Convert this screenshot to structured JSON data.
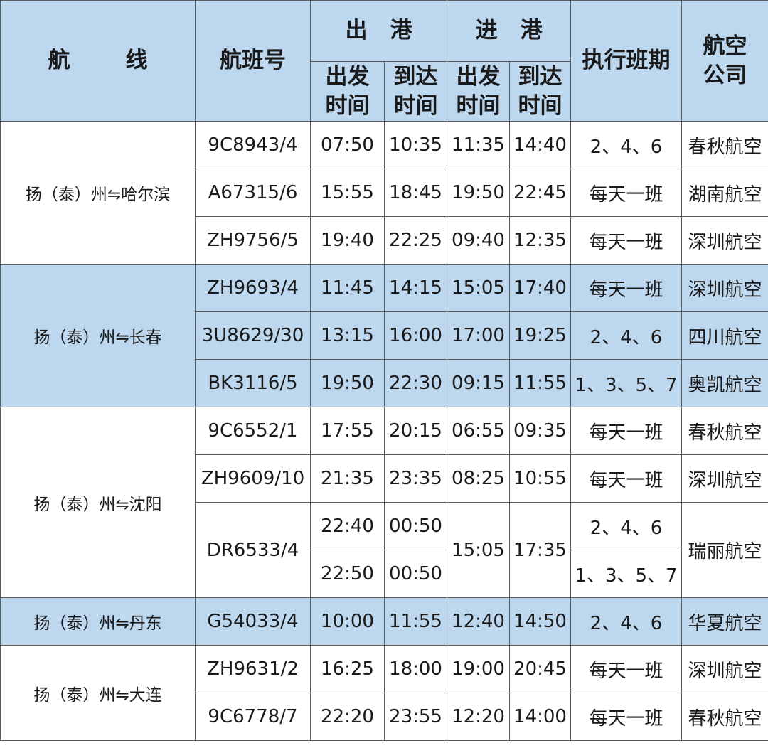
{
  "header": {
    "route": [
      "航",
      "线"
    ],
    "flight_no": "航班号",
    "outbound": [
      "出",
      "港"
    ],
    "inbound": [
      "进",
      "港"
    ],
    "depart": [
      "出发",
      "时间"
    ],
    "arrive": [
      "到达",
      "时间"
    ],
    "schedule": "执行班期",
    "airline": [
      "航空",
      "公司"
    ]
  },
  "routes": [
    {
      "name": "扬（泰）州⇋哈尔滨",
      "flights": [
        {
          "no": "9C8943/4",
          "out_dep": "07:50",
          "out_arr": "10:35",
          "in_dep": "11:35",
          "in_arr": "14:40",
          "schedule": "2、4、6",
          "airline": "春秋航空"
        },
        {
          "no": "A67315/6",
          "out_dep": "15:55",
          "out_arr": "18:45",
          "in_dep": "19:50",
          "in_arr": "22:45",
          "schedule": "每天一班",
          "airline": "湖南航空"
        },
        {
          "no": "ZH9756/5",
          "out_dep": "19:40",
          "out_arr": "22:25",
          "in_dep": "09:40",
          "in_arr": "12:35",
          "schedule": "每天一班",
          "airline": "深圳航空"
        }
      ]
    },
    {
      "name": "扬（泰）州⇋长春",
      "flights": [
        {
          "no": "ZH9693/4",
          "out_dep": "11:45",
          "out_arr": "14:15",
          "in_dep": "15:05",
          "in_arr": "17:40",
          "schedule": "每天一班",
          "airline": "深圳航空"
        },
        {
          "no": "3U8629/30",
          "out_dep": "13:15",
          "out_arr": "16:00",
          "in_dep": "17:00",
          "in_arr": "19:25",
          "schedule": "2、4、6",
          "airline": "四川航空"
        },
        {
          "no": "BK3116/5",
          "out_dep": "19:50",
          "out_arr": "22:30",
          "in_dep": "09:15",
          "in_arr": "11:55",
          "schedule": "1、3、5、7",
          "airline": "奥凯航空"
        }
      ]
    },
    {
      "name": "扬（泰）州⇋沈阳",
      "flights": [
        {
          "no": "9C6552/1",
          "out_dep": "17:55",
          "out_arr": "20:15",
          "in_dep": "06:55",
          "in_arr": "09:35",
          "schedule": "每天一班",
          "airline": "春秋航空"
        },
        {
          "no": "ZH9609/10",
          "out_dep": "21:35",
          "out_arr": "23:35",
          "in_dep": "08:25",
          "in_arr": "10:55",
          "schedule": "每天一班",
          "airline": "深圳航空"
        },
        {
          "no": "DR6533/4",
          "in_dep": "15:05",
          "in_arr": "17:35",
          "airline": "瑞丽航空",
          "variants": [
            {
              "out_dep": "22:40",
              "out_arr": "00:50",
              "schedule": "2、4、6"
            },
            {
              "out_dep": "22:50",
              "out_arr": "00:50",
              "schedule": "1、3、5、7"
            }
          ]
        }
      ]
    },
    {
      "name": "扬（泰）州⇋丹东",
      "flights": [
        {
          "no": "G54033/4",
          "out_dep": "10:00",
          "out_arr": "11:55",
          "in_dep": "12:40",
          "in_arr": "14:50",
          "schedule": "2、4、6",
          "airline": "华夏航空"
        }
      ]
    },
    {
      "name": "扬（泰）州⇋大连",
      "flights": [
        {
          "no": "ZH9631/2",
          "out_dep": "16:25",
          "out_arr": "18:00",
          "in_dep": "19:00",
          "in_arr": "20:45",
          "schedule": "每天一班",
          "airline": "深圳航空"
        },
        {
          "no": "9C6778/7",
          "out_dep": "22:20",
          "out_arr": "23:55",
          "in_dep": "12:20",
          "in_arr": "14:00",
          "schedule": "每天一班",
          "airline": "春秋航空"
        }
      ]
    }
  ],
  "colors": {
    "band": "#bdd7ee",
    "header": "#bdd7ee",
    "border": "#5a5a5a",
    "text": "#1a1a1a"
  }
}
